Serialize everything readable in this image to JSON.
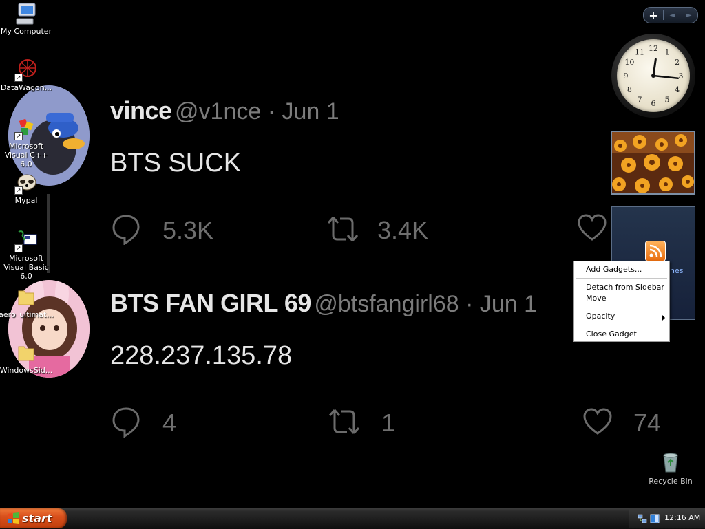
{
  "desktop_icons": [
    {
      "label": "My Computer"
    },
    {
      "label": "DataWagon..."
    },
    {
      "label": "Microsoft Visual C++ 6.0"
    },
    {
      "label": "Mypal"
    },
    {
      "label": "Microsoft Visual Basic 6.0"
    },
    {
      "label": "aero_ultimat..."
    },
    {
      "label": "WindowsSid..."
    }
  ],
  "recycle_bin": {
    "label": "Recycle Bin"
  },
  "wallpaper_tweets": [
    {
      "name": "vince",
      "handle_date": "@v1nce · Jun 1",
      "text": "BTS SUCK",
      "replies": "5.3K",
      "retweets": "3.4K",
      "likes": ""
    },
    {
      "name": "BTS FAN GIRL 69",
      "handle_date": "@btsfangirl68 · Jun 1",
      "text": "228.237.135.78",
      "replies": "4",
      "retweets": "1",
      "likes": "74"
    }
  ],
  "sidebar": {
    "add_label": "+",
    "prev_label": "◄",
    "next_label": "►",
    "feed_link_fragment": "nes"
  },
  "context_menu": {
    "items": [
      "Add Gadgets...",
      "Detach from Sidebar",
      "Move",
      "Opacity",
      "Close Gadget"
    ]
  },
  "taskbar": {
    "start_label": "start",
    "clock": "12:16 AM"
  },
  "clock_time": {
    "hour": 12,
    "minute": 16
  }
}
